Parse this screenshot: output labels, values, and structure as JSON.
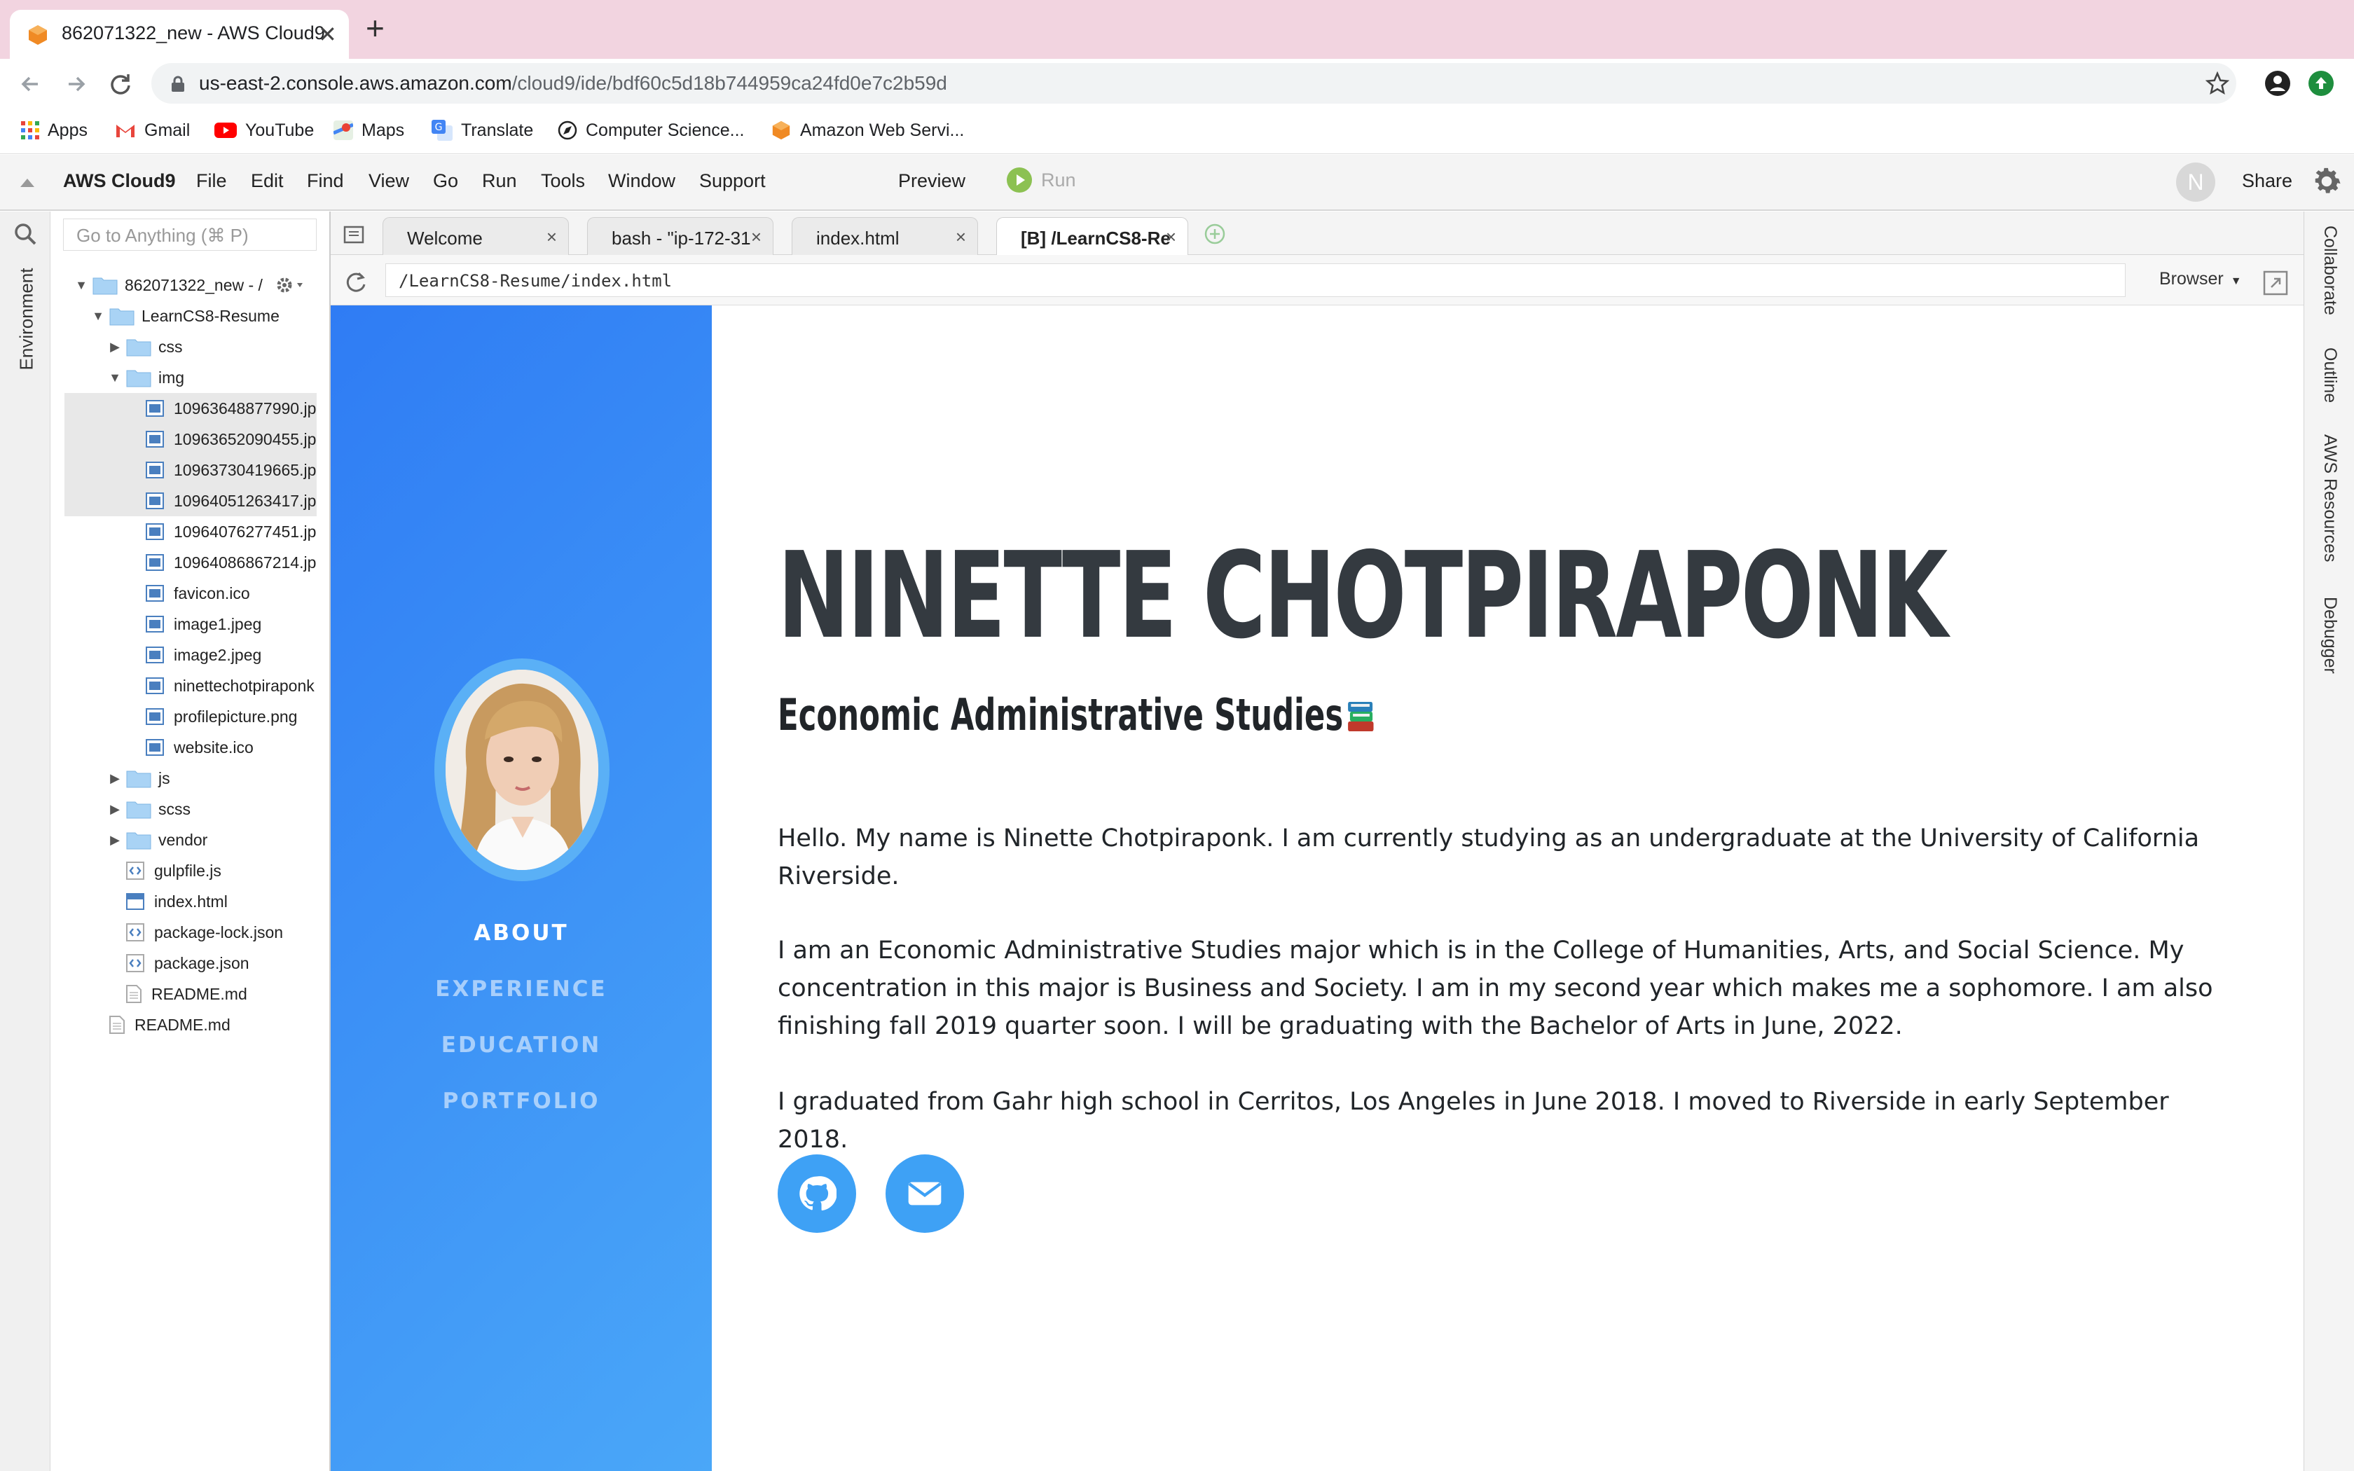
{
  "browser": {
    "tab_title": "862071322_new - AWS Cloud9",
    "url_host": "us-east-2.console.aws.amazon.com",
    "url_path": "/cloud9/ide/bdf60c5d18b744959ca24fd0e7c2b59d",
    "bookmarks": [
      "Apps",
      "Gmail",
      "YouTube",
      "Maps",
      "Translate",
      "Computer Science...",
      "Amazon Web Servi..."
    ]
  },
  "cloud9": {
    "title": "AWS Cloud9",
    "menus": [
      "File",
      "Edit",
      "Find",
      "View",
      "Go",
      "Run",
      "Tools",
      "Window",
      "Support"
    ],
    "preview": "Preview",
    "run": "Run",
    "avatar_letter": "N",
    "share": "Share",
    "search_placeholder": "Go to Anything (⌘ P)",
    "environment_label": "Environment",
    "right_panels": [
      "Collaborate",
      "Outline",
      "AWS Resources",
      "Debugger"
    ],
    "tree": {
      "root": "862071322_new - /",
      "project": "LearnCS8-Resume",
      "folders": [
        "css",
        "img"
      ],
      "img_files": [
        "10963648877990.jp",
        "10963652090455.jp",
        "10963730419665.jp",
        "10964051263417.jp",
        "10964076277451.jp",
        "10964086867214.jp",
        "favicon.ico",
        "image1.jpeg",
        "image2.jpeg",
        "ninettechotpiraponk",
        "profilepicture.png",
        "website.ico"
      ],
      "more_folders": [
        "js",
        "scss",
        "vendor"
      ],
      "project_files": [
        "gulpfile.js",
        "index.html",
        "package-lock.json",
        "package.json",
        "README.md"
      ],
      "root_files": [
        "README.md"
      ]
    },
    "editor_tabs": [
      "Welcome",
      "bash - \"ip-172-31",
      "index.html",
      "[B] /LearnCS8-Re"
    ],
    "preview_url": "/LearnCS8-Resume/index.html",
    "browser_select": "Browser"
  },
  "resume": {
    "nav": [
      "ABOUT",
      "EXPERIENCE",
      "EDUCATION",
      "PORTFOLIO"
    ],
    "name": "NINETTE CHOTPIRAPONK",
    "subheading": "Economic Administrative Studies",
    "paragraphs": [
      "Hello. My name is Ninette Chotpiraponk. I am currently studying as an undergraduate at the University of California Riverside.",
      "I am an Economic Administrative Studies major which is in the College of Humanities, Arts, and Social Science. My concentration in this major is Business and Society. I am in my second year which makes me a sophomore. I am also finishing fall 2019 quarter soon. I will be graduating with the Bachelor of Arts in June, 2022.",
      "I graduated from Gahr high school in Cerritos, Los Angeles in June 2018. I moved to Riverside in early September 2018."
    ],
    "social_icons": [
      "github-icon",
      "envelope-icon"
    ]
  }
}
